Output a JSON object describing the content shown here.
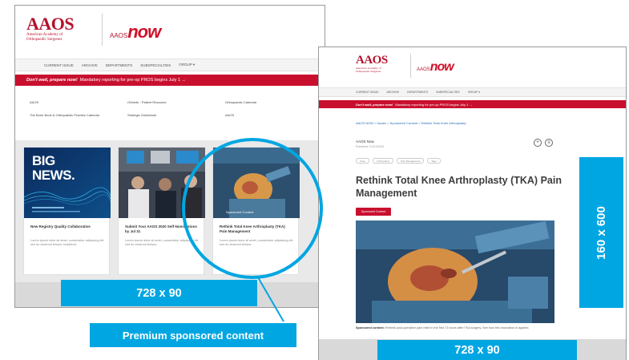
{
  "brand": {
    "aaos": "AAOS",
    "aaos_sub": "American Academy of Orthopaedic Surgeons",
    "now_prefix": "AAOS",
    "now": "NOW"
  },
  "left_page": {
    "nav": [
      "Current Issue",
      "Archive",
      "Departments",
      "Subspecialties",
      "Group ▾"
    ],
    "banner_bold": "Don't wait, prepare now!",
    "banner_text": "Mandatory reporting for pre-op PROS begins July 1 →",
    "links": [
      "AAOS",
      "Orthinfo - Patient Resource",
      "Orthopaedic Calendar",
      "The Bone Book & Orthopaedic Practice Calendar",
      "Strategic Guidebook",
      "AAOS"
    ],
    "cards": [
      {
        "title": "New Registry Quality Collaborative",
        "text": "Lorem ipsum dolor sit amet, consectetur adipiscing elit sed do eiusmod tempor incididunt."
      },
      {
        "title": "Submit Your AAOS 2020 Self-Nominations by Jul 31",
        "text": "Lorem ipsum dolor sit amet, consectetur adipiscing elit sed do eiusmod tempor."
      },
      {
        "title": "Rethink Total Knee Arthroplasty (TKA) Pain Management",
        "text": "Lorem ipsum dolor sit amet, consectetur adipiscing elit sed do eiusmod tempor."
      }
    ],
    "big_news": "BIG\nNEWS.",
    "sponsored_badge": "Sponsored Content"
  },
  "right_page": {
    "nav": [
      "Current Issue",
      "Archive",
      "Departments",
      "Subspecialties",
      "Group ▾"
    ],
    "banner_bold": "Don't wait, prepare now!",
    "banner_text": "Mandatory reporting for pre-op PROS begins July 1 →",
    "breadcrumbs": "AAOS NOW > Issues > Sponsored Content > Rethink Total Knee Arthroplasty",
    "section": "AAOS Now",
    "issue": "Published: 01/01/2020",
    "tags": [
      "Knee",
      "Arthroplasty",
      "Pain Management",
      "Tags"
    ],
    "title": "Rethink Total Knee Arthroplasty (TKA) Pain Management",
    "button": "Sponsored Content",
    "caption_bold": "Sponsored content:",
    "caption_text": "Rethink post-operative pain relief in the first 72 hours after TKA surgery. See how this innovation is applied."
  },
  "callouts": {
    "left_leaderboard": "728 x 90",
    "right_leaderboard": "728 x 90",
    "skyscraper": "160 x 600",
    "premium": "Premium sponsored content"
  },
  "colors": {
    "accent": "#00a6e2",
    "brand_red": "#c8102e"
  }
}
